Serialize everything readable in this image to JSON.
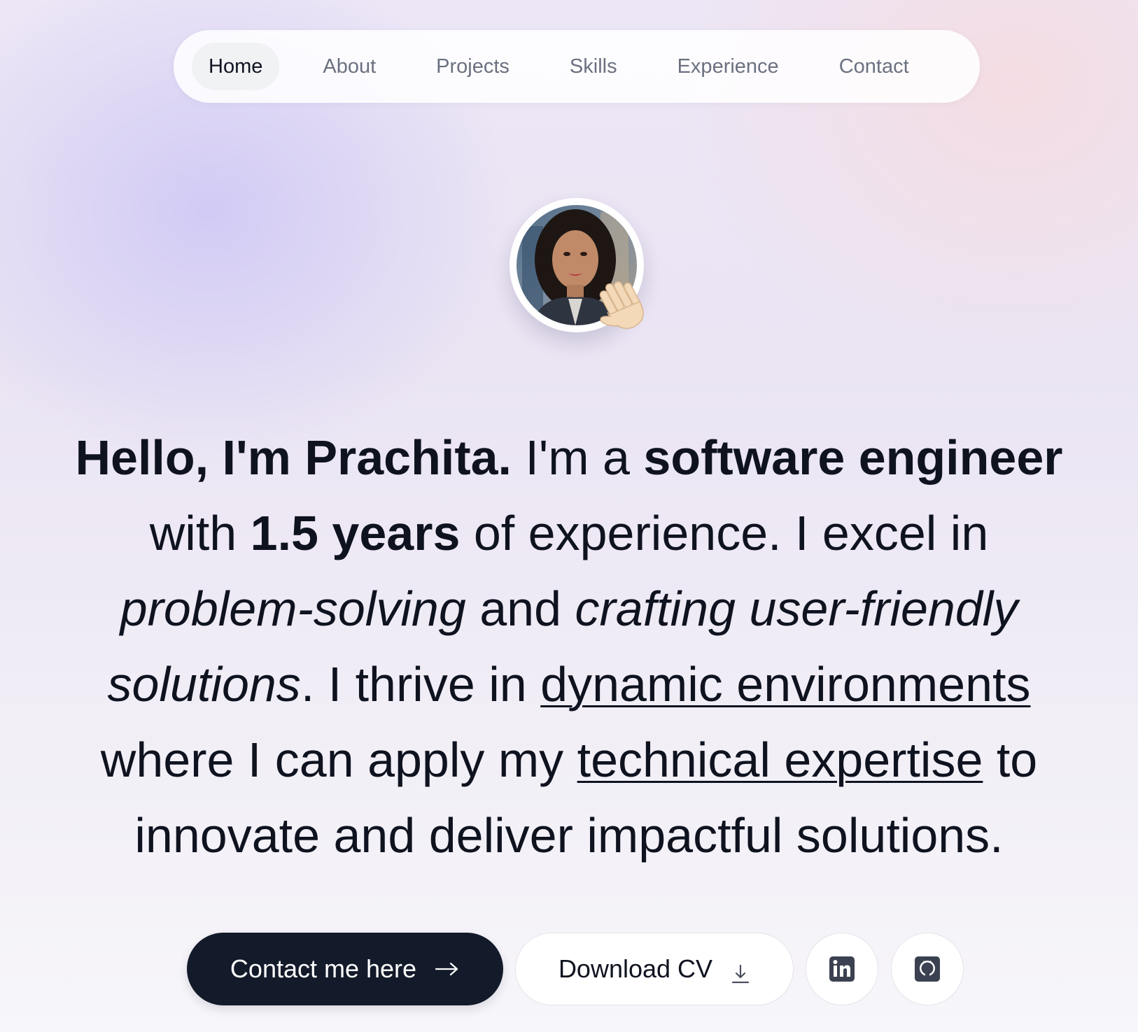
{
  "nav": {
    "items": [
      {
        "label": "Home",
        "active": true
      },
      {
        "label": "About",
        "active": false
      },
      {
        "label": "Projects",
        "active": false
      },
      {
        "label": "Skills",
        "active": false
      },
      {
        "label": "Experience",
        "active": false
      },
      {
        "label": "Contact",
        "active": false
      }
    ]
  },
  "avatar": {
    "badge_icon": "waving-hand-icon"
  },
  "hero": {
    "greeting": "Hello, I'm Prachita.",
    "t1": " I'm a ",
    "role": "software engineer",
    "t2": " with ",
    "years": "1.5 years",
    "t3": " of experience. I excel in ",
    "skill1": "problem-solving",
    "t4": " and ",
    "skill2": "crafting user-friendly solutions",
    "t5": ". I thrive in ",
    "link1": "dynamic environments",
    "t6": " where I can apply my ",
    "link2": "technical expertise",
    "t7": " to innovate and deliver impactful solutions."
  },
  "actions": {
    "contact_label": "Contact me here",
    "contact_icon": "arrow-right-icon",
    "download_label": "Download CV",
    "download_icon": "download-icon",
    "linkedin_icon": "linkedin-icon",
    "github_icon": "github-icon"
  },
  "colors": {
    "primary_button": "#131a29",
    "text": "#0f1320",
    "nav_inactive": "#6b7180"
  }
}
